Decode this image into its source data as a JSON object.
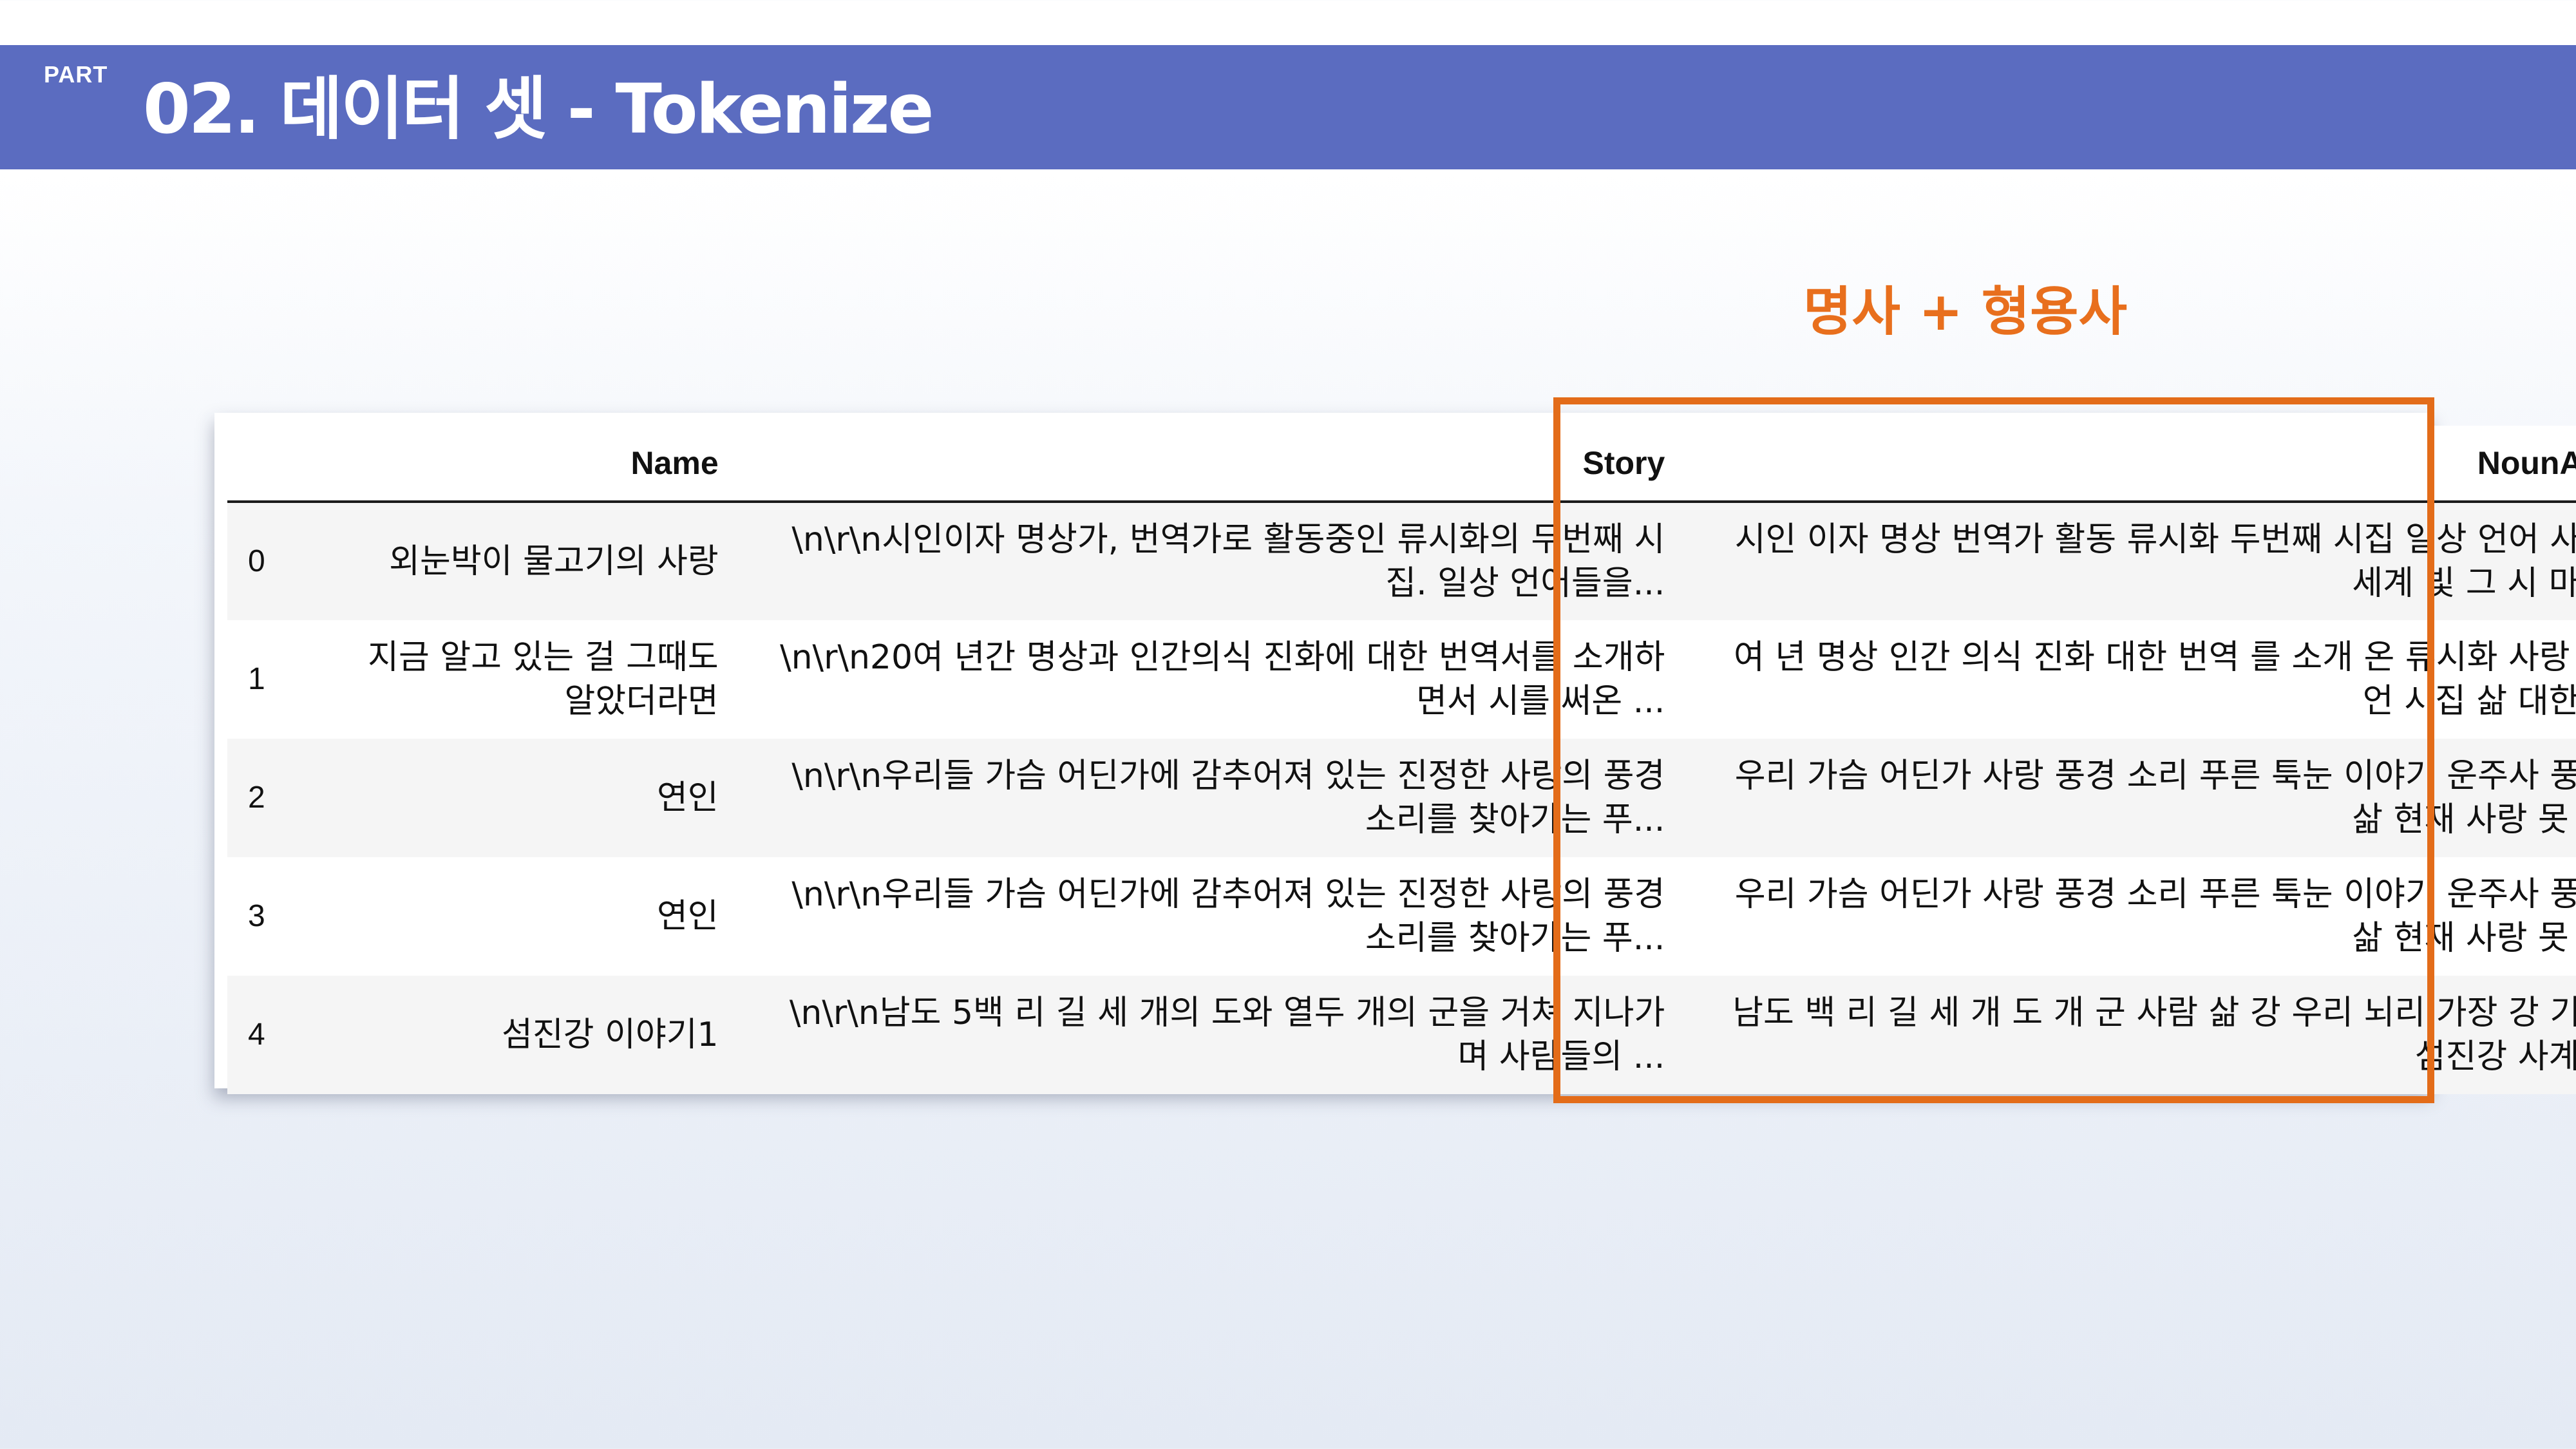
{
  "header": {
    "part_label": "PART",
    "title": "02. 데이터 셋 - Tokenize",
    "bar_color": "#5b6cc0"
  },
  "annotation": {
    "text": "명사 + 형용사",
    "color": "#e86f1d"
  },
  "highlight": {
    "color": "#e36c19",
    "target_column": "NounAdj"
  },
  "table": {
    "columns": [
      "",
      "Name",
      "Story",
      "NounAdj"
    ],
    "rows": [
      {
        "index": "0",
        "name": "외눈박이 물고기의 사랑",
        "story": "\\n\\r\\n시인이자 명상가, 번역가로 활동중인 류시화의 두번째 시집. 일상 언어들을...",
        "nounadj": "시인 이자 명상 번역가 활동 류시화 두번째 시집 일상 언어 사용 세계 빛 그 시 마..."
      },
      {
        "index": "1",
        "name": "지금 알고 있는 걸 그때도 알았더라면",
        "story": "\\n\\r\\n20여 년간 명상과 인간의식 진화에 대한 번역서를 소개하면서 시를 써온 ...",
        "nounadj": "여 년 명상 인간 의식 진화 대한 번역 를 소개 온 류시화 사랑 잠언 시집 삶 대한..."
      },
      {
        "index": "2",
        "name": "연인",
        "story": "\\n\\r\\n우리들 가슴 어딘가에 감추어져 있는 진정한 사랑의 풍경소리를 찾아가는 푸...",
        "nounadj": "우리 가슴 어딘가 사랑 풍경 소리 푸른 툭눈 이야기 운주사 풍경 삶 현재 사랑 못 ..."
      },
      {
        "index": "3",
        "name": "연인",
        "story": "\\n\\r\\n우리들 가슴 어딘가에 감추어져 있는 진정한 사랑의 풍경소리를 찾아가는 푸...",
        "nounadj": "우리 가슴 어딘가 사랑 풍경 소리 푸른 툭눈 이야기 운주사 풍경 삶 현재 사랑 못 ..."
      },
      {
        "index": "4",
        "name": "섬진강 이야기1",
        "story": "\\n\\r\\n남도 5백 리 길 세 개의 도와 열두 개의 군을 거쳐 지나가며 사람들의 ...",
        "nounadj": "남도 백 리 길 세 개 도 개 군 사람 삶 강 우리 뇌리 가장 강 기억 섬진강 사계..."
      }
    ]
  }
}
